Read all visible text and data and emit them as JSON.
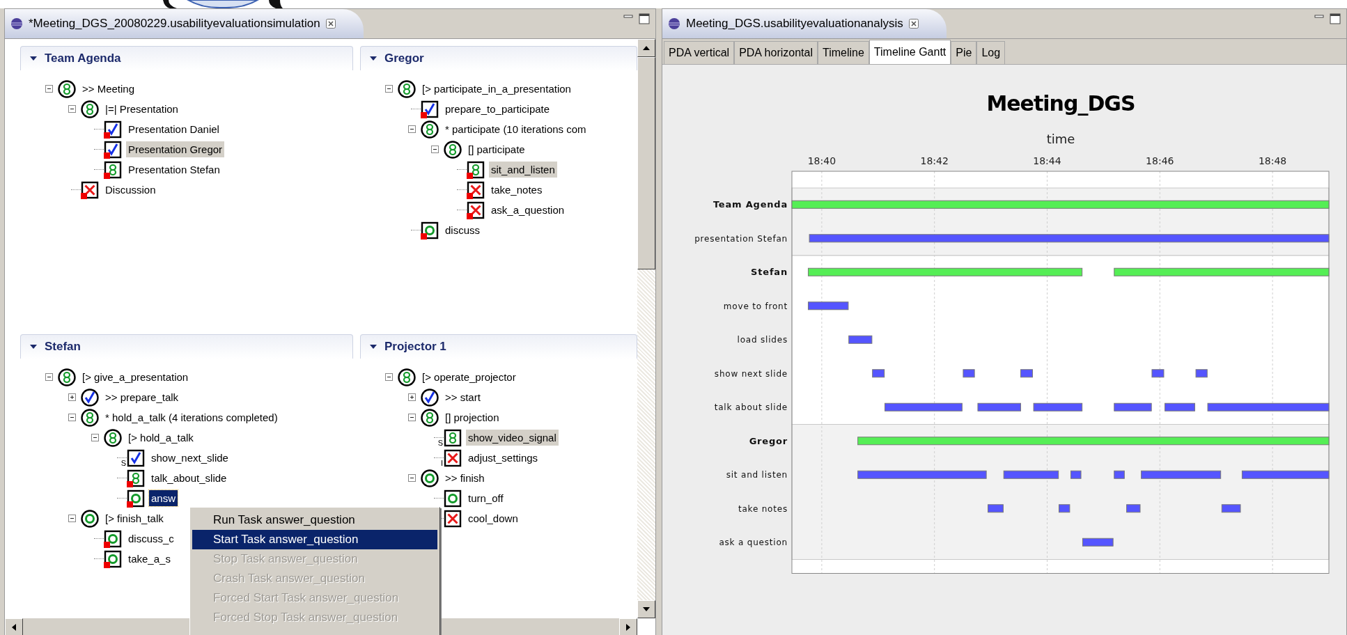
{
  "left_editor": {
    "tab_title": "*Meeting_DGS_20080229.usabilityevaluationsimulation",
    "sections": [
      {
        "title": "Team Agenda",
        "expanded": true,
        "tree": [
          {
            "label": ">> Meeting",
            "kind": "running",
            "expanded": true,
            "selected": false,
            "highlighted": false,
            "marker": false,
            "children": [
              {
                "label": "|=| Presentation",
                "kind": "running",
                "expanded": true,
                "selected": false,
                "highlighted": false,
                "marker": false,
                "children": [
                  {
                    "label": "Presentation Daniel",
                    "kind": "done",
                    "selected": false,
                    "highlighted": false,
                    "marker": true
                  },
                  {
                    "label": "Presentation Gregor",
                    "kind": "done",
                    "selected": false,
                    "highlighted": true,
                    "marker": true
                  },
                  {
                    "label": "Presentation Stefan",
                    "kind": "running",
                    "selected": false,
                    "highlighted": false,
                    "marker": true
                  }
                ]
              },
              {
                "label": "Discussion",
                "kind": "failed",
                "selected": false,
                "highlighted": false,
                "marker": true
              }
            ]
          }
        ]
      },
      {
        "title": "Gregor",
        "expanded": true,
        "tree": [
          {
            "label": "[> participate_in_a_presentation",
            "kind": "running",
            "expanded": true,
            "selected": false,
            "highlighted": false,
            "marker": false,
            "children": [
              {
                "label": "prepare_to_participate",
                "kind": "done",
                "selected": false,
                "highlighted": false,
                "marker": true
              },
              {
                "label": "* participate (10 iterations com",
                "kind": "running",
                "expanded": true,
                "selected": false,
                "highlighted": false,
                "marker": false,
                "children": [
                  {
                    "label": "[] participate",
                    "kind": "running",
                    "expanded": true,
                    "selected": false,
                    "highlighted": false,
                    "marker": false,
                    "children": [
                      {
                        "label": "sit_and_listen",
                        "kind": "running",
                        "selected": false,
                        "highlighted": true,
                        "marker": true
                      },
                      {
                        "label": "take_notes",
                        "kind": "failed",
                        "selected": false,
                        "highlighted": false,
                        "marker": true
                      },
                      {
                        "label": "ask_a_question",
                        "kind": "failed",
                        "selected": false,
                        "highlighted": false,
                        "marker": true
                      }
                    ]
                  }
                ]
              },
              {
                "label": "discuss",
                "kind": "waiting",
                "selected": false,
                "highlighted": false,
                "marker": true
              }
            ]
          }
        ]
      },
      {
        "title": "Stefan",
        "expanded": true,
        "tree": [
          {
            "label": "[> give_a_presentation",
            "kind": "running",
            "expanded": true,
            "selected": false,
            "highlighted": false,
            "marker": false,
            "children": [
              {
                "label": ">> prepare_talk",
                "kind": "done",
                "expanded": false,
                "selected": false,
                "highlighted": false,
                "marker": false
              },
              {
                "label": "* hold_a_talk (4 iterations completed)",
                "kind": "running",
                "expanded": true,
                "selected": false,
                "highlighted": false,
                "marker": false,
                "children": [
                  {
                    "label": "[> hold_a_talk",
                    "kind": "running",
                    "expanded": true,
                    "selected": false,
                    "highlighted": false,
                    "marker": false,
                    "children": [
                      {
                        "label": "show_next_slide",
                        "kind": "done",
                        "prefix": "S",
                        "selected": false,
                        "highlighted": false,
                        "marker": false
                      },
                      {
                        "label": "talk_about_slide",
                        "kind": "running",
                        "selected": false,
                        "highlighted": false,
                        "marker": true
                      },
                      {
                        "label": "answ",
                        "kind": "waiting",
                        "selected": true,
                        "highlighted": false,
                        "marker": true
                      }
                    ]
                  }
                ]
              },
              {
                "label": "[> finish_talk",
                "kind": "waiting",
                "expanded": true,
                "selected": false,
                "highlighted": false,
                "marker": false,
                "children": [
                  {
                    "label": "discuss_c",
                    "kind": "waiting",
                    "selected": false,
                    "highlighted": false,
                    "marker": true
                  },
                  {
                    "label": "take_a_s",
                    "kind": "waiting",
                    "selected": false,
                    "highlighted": false,
                    "marker": true
                  }
                ]
              }
            ]
          }
        ]
      },
      {
        "title": "Projector 1",
        "expanded": true,
        "tree": [
          {
            "label": "[> operate_projector",
            "kind": "running",
            "expanded": true,
            "selected": false,
            "highlighted": false,
            "marker": false,
            "children": [
              {
                "label": ">> start",
                "kind": "done",
                "expanded": false,
                "selected": false,
                "highlighted": false,
                "marker": false
              },
              {
                "label": "[] projection",
                "kind": "running",
                "expanded": true,
                "selected": false,
                "highlighted": false,
                "marker": false,
                "children": [
                  {
                    "label": "show_video_signal",
                    "kind": "running",
                    "prefix": "S",
                    "selected": false,
                    "highlighted": true,
                    "marker": false
                  },
                  {
                    "label": "adjust_settings",
                    "kind": "failed",
                    "prefix": "I",
                    "selected": false,
                    "highlighted": false,
                    "marker": false
                  }
                ]
              },
              {
                "label": ">> finish",
                "kind": "waiting",
                "expanded": true,
                "selected": false,
                "highlighted": false,
                "marker": false,
                "children": [
                  {
                    "label": "turn_off",
                    "kind": "waiting",
                    "selected": false,
                    "highlighted": false,
                    "marker": false
                  },
                  {
                    "label": "cool_down",
                    "kind": "failed",
                    "selected": false,
                    "highlighted": false,
                    "marker": false
                  }
                ]
              }
            ]
          }
        ]
      }
    ]
  },
  "context_menu": {
    "items": [
      {
        "label": "Run Task answer_question",
        "selected": false,
        "disabled": false
      },
      {
        "label": "Start Task answer_question",
        "selected": true,
        "disabled": false
      },
      {
        "label": "Stop Task answer_question",
        "selected": false,
        "disabled": true
      },
      {
        "label": "Crash Task answer_question",
        "selected": false,
        "disabled": true
      },
      {
        "label": "Forced Start Task answer_question",
        "selected": false,
        "disabled": true
      },
      {
        "label": "Forced Stop Task answer_question",
        "selected": false,
        "disabled": true
      }
    ]
  },
  "right_editor": {
    "tab_title": "Meeting_DGS.usabilityevaluationanalysis",
    "tabs": [
      {
        "label": "PDA vertical",
        "selected": false
      },
      {
        "label": "PDA horizontal",
        "selected": false
      },
      {
        "label": "Timeline",
        "selected": false
      },
      {
        "label": "Timeline Gantt",
        "selected": true
      },
      {
        "label": "Pie",
        "selected": false
      },
      {
        "label": "Log",
        "selected": false
      }
    ],
    "timeline_chart": {
      "title": "Meeting_DGS",
      "axis_title": "time",
      "ticks": [
        "18:40",
        "18:42",
        "18:44",
        "18:46",
        "18:48"
      ],
      "rows": [
        {
          "label": "Team Agenda",
          "kind": "group"
        },
        {
          "label": "presentation Stefan",
          "kind": "task"
        },
        {
          "label": "Stefan",
          "kind": "group"
        },
        {
          "label": "move to front",
          "kind": "task"
        },
        {
          "label": "load slides",
          "kind": "task"
        },
        {
          "label": "show next slide",
          "kind": "task"
        },
        {
          "label": "talk about slide",
          "kind": "task"
        },
        {
          "label": "Gregor",
          "kind": "group"
        },
        {
          "label": "sit and listen",
          "kind": "task"
        },
        {
          "label": "take notes",
          "kind": "task"
        },
        {
          "label": "ask a question",
          "kind": "task"
        }
      ]
    }
  }
}
